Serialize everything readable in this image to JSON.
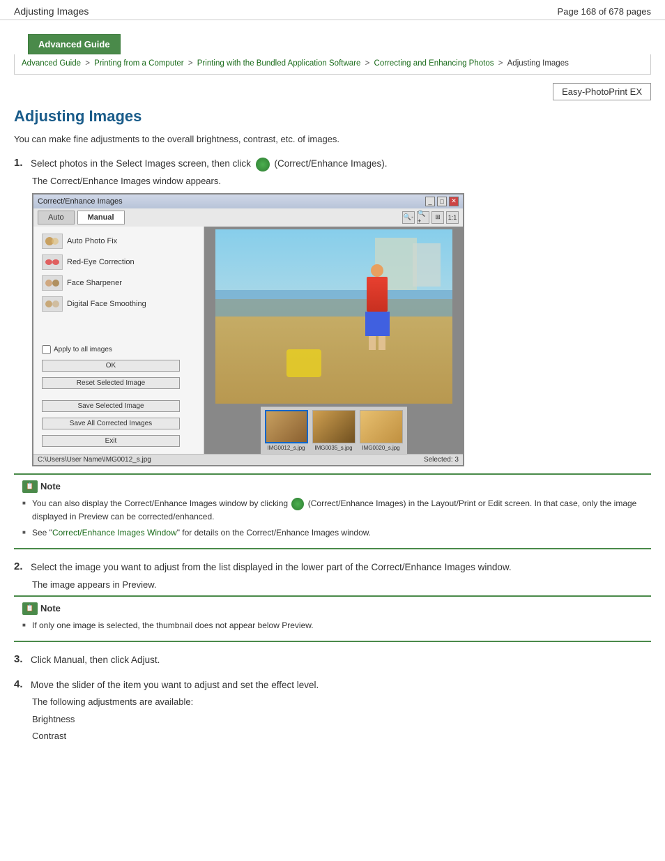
{
  "header": {
    "title": "Adjusting Images",
    "page_info": "Page 168 of 678 pages"
  },
  "banner": {
    "label": "Advanced Guide"
  },
  "breadcrumb": {
    "items": [
      {
        "label": "Advanced Guide",
        "link": true
      },
      {
        "label": "Printing from a Computer",
        "link": true
      },
      {
        "label": "Printing with the Bundled Application Software",
        "link": true
      },
      {
        "label": "Correcting and Enhancing Photos",
        "link": true
      },
      {
        "label": "Adjusting Images",
        "link": false
      }
    ]
  },
  "epp_button": {
    "label": "Easy-PhotoPrint EX"
  },
  "page": {
    "main_title": "Adjusting Images",
    "intro": "You can make fine adjustments to the overall brightness, contrast, etc. of images.",
    "steps": [
      {
        "num": "1.",
        "text": "Select photos in the Select Images screen, then click",
        "text2": "(Correct/Enhance Images).",
        "sub": "The Correct/Enhance Images window appears."
      },
      {
        "num": "2.",
        "text": "Select the image you want to adjust from the list displayed in the lower part of the Correct/Enhance Images window.",
        "sub": "The image appears in Preview."
      },
      {
        "num": "3.",
        "text": "Click Manual, then click Adjust."
      },
      {
        "num": "4.",
        "text": "Move the slider of the item you want to adjust and set the effect level.",
        "sub": "The following adjustments are available:",
        "adjustments": [
          "Brightness",
          "Contrast"
        ]
      }
    ]
  },
  "screenshot": {
    "title": "Correct/Enhance Images",
    "tabs": [
      "Auto",
      "Manual"
    ],
    "active_tab": "Manual",
    "menu_items": [
      {
        "label": "Auto Photo Fix"
      },
      {
        "label": "Red-Eye Correction"
      },
      {
        "label": "Face Sharpener"
      },
      {
        "label": "Digital Face Smoothing"
      }
    ],
    "checkbox_label": "Apply to all images",
    "buttons": [
      "OK",
      "Reset Selected Image",
      "Save Selected Image",
      "Save All Corrected Images",
      "Exit"
    ],
    "thumbnails": [
      {
        "name": "IMG0012_s.jpg",
        "selected": true
      },
      {
        "name": "IMG0035_s.jpg",
        "selected": false
      },
      {
        "name": "IMG0020_s.jpg",
        "selected": false
      }
    ],
    "status_left": "C:\\Users\\User Name\\IMG0012_s.jpg",
    "status_right": "Selected: 3"
  },
  "notes": {
    "note1": {
      "title": "Note",
      "items": [
        "You can also display the Correct/Enhance Images window by clicking    (Correct/Enhance Images) in the Layout/Print or Edit screen. In that case, only the image displayed in Preview can be corrected/enhanced.",
        "See \"Correct/Enhance Images Window\" for details on the Correct/Enhance Images window."
      ]
    },
    "note2": {
      "title": "Note",
      "items": [
        "If only one image is selected, the thumbnail does not appear below Preview."
      ]
    }
  }
}
